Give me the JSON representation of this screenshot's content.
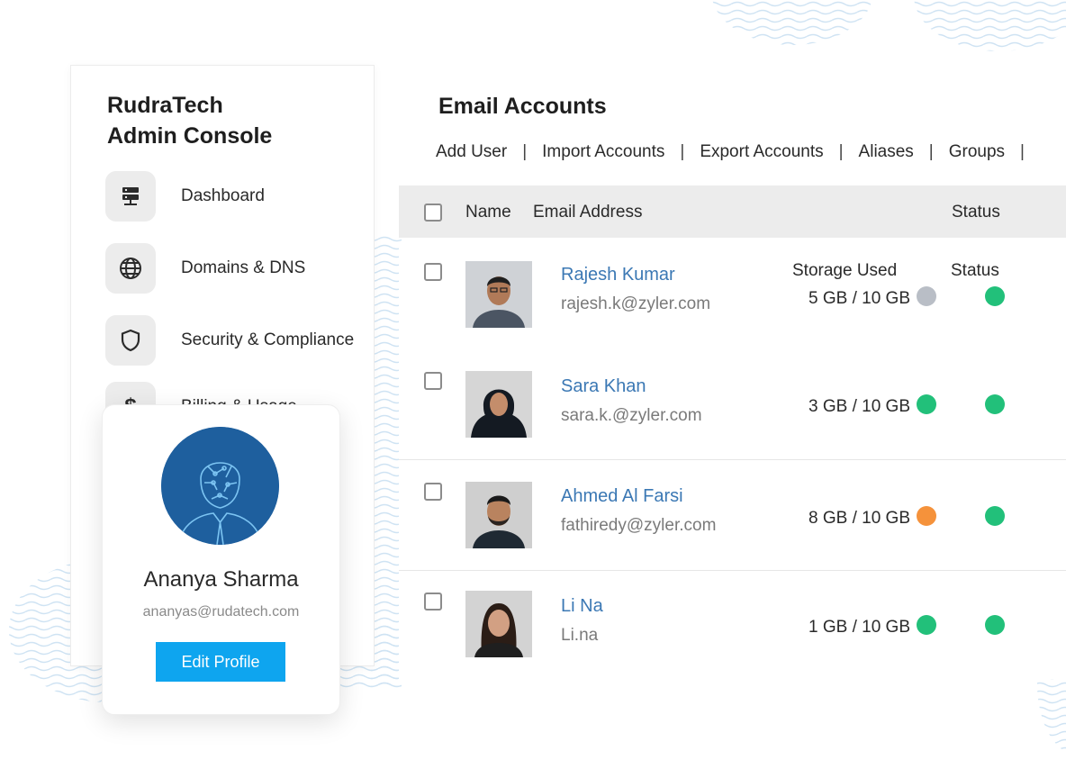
{
  "colors": {
    "accent": "#0ea5ef",
    "name_link": "#3b78b4",
    "status_green": "#22c07a",
    "status_orange": "#f5923b",
    "status_gray": "#b9bec6",
    "avatar_blue": "#1e5f9e"
  },
  "sidebar": {
    "brand": "RudraTech\nAdmin Console",
    "items": [
      {
        "label": "Dashboard",
        "icon": "server-icon"
      },
      {
        "label": "Domains & DNS",
        "icon": "globe-icon"
      },
      {
        "label": "Security & Compliance",
        "icon": "shield-icon"
      },
      {
        "label": "Billing & Usage",
        "icon": "dollar-icon"
      }
    ]
  },
  "profile": {
    "name": "Ananya Sharma",
    "email": "ananyas@rudatech.com",
    "edit_label": "Edit Profile"
  },
  "main": {
    "title": "Email Accounts",
    "toolbar": [
      "Add User",
      "Import Accounts",
      "Export Accounts",
      "Aliases",
      "Groups"
    ],
    "columns": {
      "name": "Name",
      "email": "Email Address",
      "status": "Status"
    },
    "sub_headers": {
      "storage": "Storage Used",
      "status": "Status"
    },
    "rows": [
      {
        "name": "Rajesh Kumar",
        "email": "rajesh.k@zyler.com",
        "storage": "5 GB / 10 GB",
        "storage_dot": "gray",
        "status_dot": "green"
      },
      {
        "name": "Sara Khan",
        "email": "sara.k.@zyler.com",
        "storage": "3 GB / 10 GB",
        "storage_dot": "green",
        "status_dot": "green"
      },
      {
        "name": "Ahmed Al Farsi",
        "email": "fathiredy@zyler.com",
        "storage": "8 GB / 10 GB",
        "storage_dot": "orange",
        "status_dot": "green"
      },
      {
        "name": "Li Na",
        "email": "Li.na",
        "storage": "1 GB / 10 GB",
        "storage_dot": "green",
        "status_dot": "green"
      }
    ]
  }
}
